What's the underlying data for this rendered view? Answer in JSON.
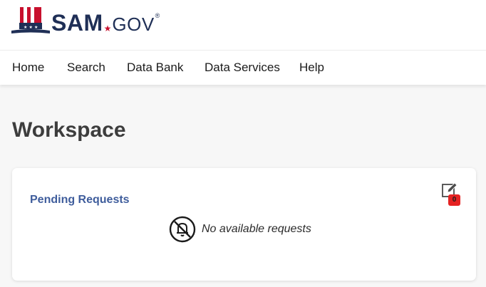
{
  "brand": {
    "name_main": "SAM",
    "name_sub": "GOV",
    "registered_mark": "®",
    "logo_icon": "uncle-sam-hat-icon",
    "colors": {
      "navy": "#1f2f56",
      "red": "#c8102e"
    }
  },
  "nav": {
    "items": [
      {
        "label": "Home"
      },
      {
        "label": "Search"
      },
      {
        "label": "Data Bank"
      },
      {
        "label": "Data Services"
      },
      {
        "label": "Help"
      }
    ]
  },
  "main": {
    "title": "Workspace",
    "card": {
      "title": "Pending Requests",
      "edit_icon": "edit-pencil-icon",
      "badge_count": "0",
      "badge_color": "#e52222",
      "empty_icon": "bell-off-icon",
      "empty_message": "No available requests"
    }
  }
}
